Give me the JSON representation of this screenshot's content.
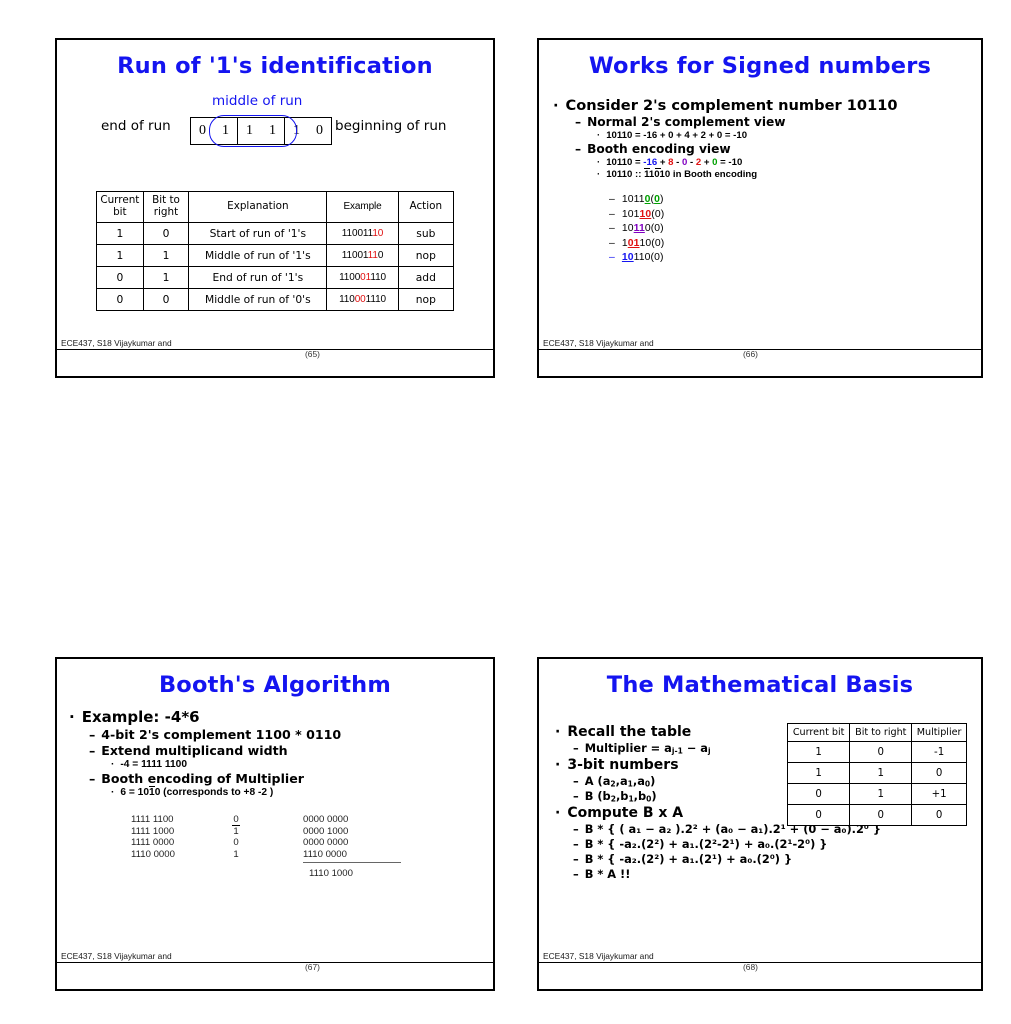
{
  "slides": [
    {
      "number": "(65)",
      "title": "Run of '1's identification",
      "footer": "ECE437, S18 Vijaykumar and",
      "diagram": {
        "middle_label": "middle of run",
        "end_label": "end of run",
        "begin_label": "beginning of run",
        "bits": [
          "0",
          "1",
          "1",
          "1",
          "1",
          "0"
        ]
      },
      "table": {
        "headers": [
          "Current bit",
          "Bit to right",
          "Explanation",
          "Example",
          "Action"
        ],
        "rows": [
          {
            "current": "1",
            "right": "0",
            "explanation": "Start of run of '1's",
            "example_pre": "110011",
            "example_hl": "10",
            "example_post": "",
            "action": "sub"
          },
          {
            "current": "1",
            "right": "1",
            "explanation": "Middle of run of '1's",
            "example_pre": "11001",
            "example_hl": "11",
            "example_post": "0",
            "action": "nop"
          },
          {
            "current": "0",
            "right": "1",
            "explanation": "End of run of '1's",
            "example_pre": "1100",
            "example_hl": "01",
            "example_post": "110",
            "action": "add"
          },
          {
            "current": "0",
            "right": "0",
            "explanation": "Middle of run of '0's",
            "example_pre": "110",
            "example_hl": "00",
            "example_post": "1110",
            "action": "nop"
          }
        ]
      }
    },
    {
      "number": "(66)",
      "title": "Works for Signed numbers",
      "footer": "ECE437, S18 Vijaykumar and",
      "bullets": {
        "consider": "Consider 2's complement number 10110",
        "normal_view": "Normal 2's complement view",
        "normal_eq": "10110 = -16 + 0 + 4 + 2 + 0 = -10",
        "booth_view": "Booth encoding view",
        "booth_eq_prefix": "10110 = ",
        "booth_terms": [
          {
            "text": "-16",
            "color": "blue"
          },
          {
            "text": " + ",
            "color": "black"
          },
          {
            "text": "8",
            "color": "red"
          },
          {
            "text": " - ",
            "color": "black"
          },
          {
            "text": "0",
            "color": "purple"
          },
          {
            "text": " - ",
            "color": "black"
          },
          {
            "text": "2",
            "color": "red"
          },
          {
            "text": " + ",
            "color": "black"
          },
          {
            "text": "0",
            "color": "green"
          },
          {
            "text": " = -10",
            "color": "black"
          }
        ],
        "booth_notation_prefix": "10110 :: ",
        "booth_notation_digits": "11010",
        "booth_notation_suffix": " in Booth encoding"
      },
      "encoding_steps": [
        {
          "pre": "1011",
          "hl": "0",
          "post": "(",
          "hl2": "0",
          "tail": ")",
          "color": "green"
        },
        {
          "pre": "101",
          "hl": "10",
          "post": "(0)",
          "hl2": "",
          "tail": "",
          "color": "red"
        },
        {
          "pre": "10",
          "hl": "11",
          "post": "0(0)",
          "hl2": "",
          "tail": "",
          "color": "purple"
        },
        {
          "pre": "1",
          "hl": "01",
          "post": "10(0)",
          "hl2": "",
          "tail": "",
          "color": "red"
        },
        {
          "pre": "",
          "hl": "10",
          "post": "110(0)",
          "hl2": "",
          "tail": "",
          "color": "blue"
        }
      ]
    },
    {
      "number": "(67)",
      "title": "Booth's Algorithm",
      "footer": "ECE437, S18 Vijaykumar and",
      "bullets": {
        "example": "Example: -4*6",
        "four_bit": "4-bit 2's complement 1100 * 0110",
        "extend": "Extend multiplicand width",
        "minus_four": "-4 = 1111 1100",
        "booth_enc": "Booth encoding of Multiplier",
        "six_prefix": "6 = 10",
        "six_bar": "1",
        "six_suffix": "0  (corresponds to +8 -2 )"
      },
      "arithmetic": {
        "multiplicands": [
          "1111 1100",
          "1111 1000",
          "1111 0000",
          "1110 0000"
        ],
        "digits": [
          "0",
          "1",
          "0",
          "1"
        ],
        "digit_bars": [
          false,
          true,
          false,
          false
        ],
        "partials": [
          "0000 0000",
          "0000 1000",
          "0000 0000",
          "1110 0000"
        ],
        "sum": "1110 1000"
      }
    },
    {
      "number": "(68)",
      "title": "The Mathematical Basis",
      "footer": "ECE437, S18 Vijaykumar and",
      "table": {
        "headers": [
          "Current bit",
          "Bit to right",
          "Multiplier"
        ],
        "rows": [
          [
            "1",
            "0",
            "-1"
          ],
          [
            "1",
            "1",
            "0"
          ],
          [
            "0",
            "1",
            "+1"
          ],
          [
            "0",
            "0",
            "0"
          ]
        ]
      },
      "bullets": {
        "recall": "Recall the table",
        "multiplier_formula": "Multiplier = a",
        "multiplier_sub1": "j-1",
        "multiplier_mid": " − a",
        "multiplier_sub2": "j",
        "three_bit": "3-bit numbers",
        "a_def": "A (a",
        "b_def": "B (b",
        "compute": "Compute B x A",
        "line1": "B * { ( a₁ − a₂ ).2² + (a₀ − a₁).2¹ + (0 − a₀).2⁰ }",
        "line2": "B * { -a₂.(2²) + a₁.(2²-2¹) + a₀.(2¹-2⁰) }",
        "line3": "B * { -a₂.(2²) + a₁.(2¹) + a₀.(2⁰) }",
        "line4": "B * A !!"
      }
    }
  ]
}
